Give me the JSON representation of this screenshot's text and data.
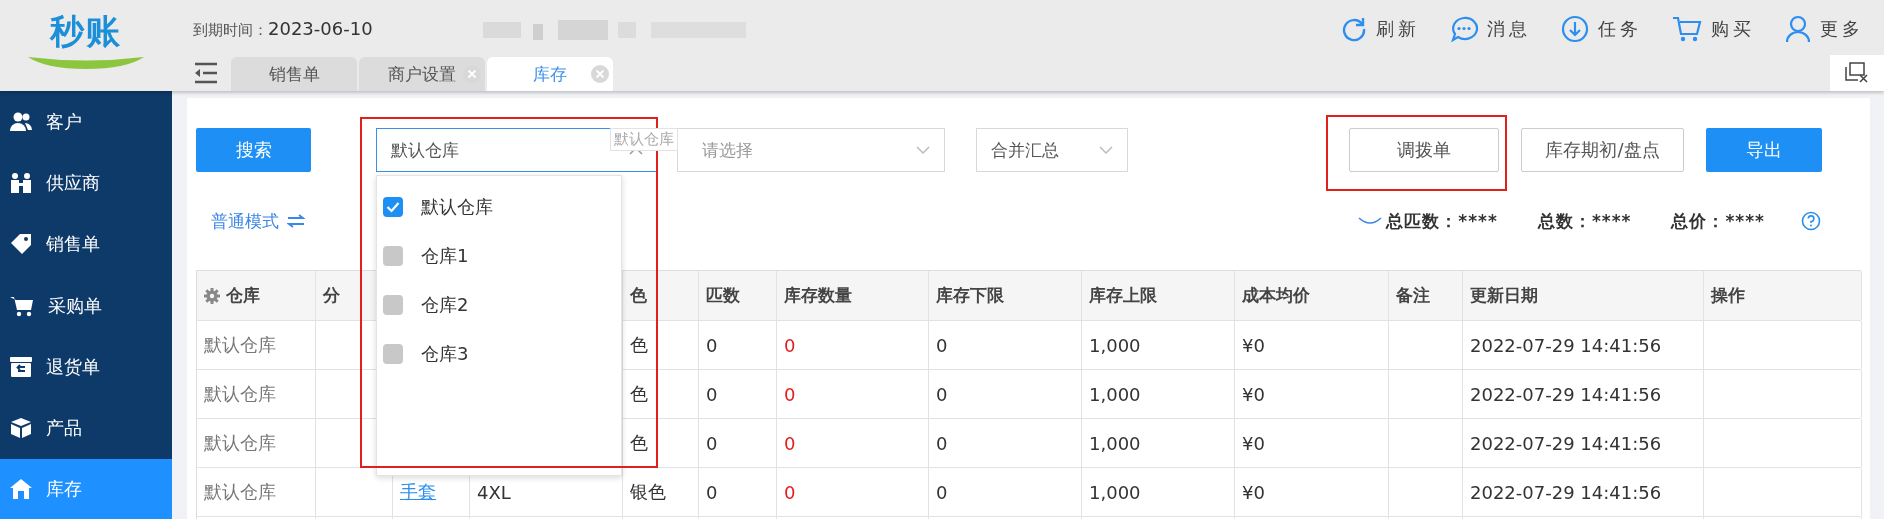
{
  "logo": {
    "text": "秒账"
  },
  "expiry": {
    "label": "到期时间：",
    "value": "2023-06-10"
  },
  "header_actions": [
    {
      "label": "刷新",
      "kind": "refresh"
    },
    {
      "label": "消息",
      "kind": "message"
    },
    {
      "label": "任务",
      "kind": "task"
    },
    {
      "label": "购买",
      "kind": "cart"
    },
    {
      "label": "更多",
      "kind": "user"
    }
  ],
  "tabs": [
    {
      "label": "销售单",
      "selected": false,
      "closable": false
    },
    {
      "label": "商户设置",
      "selected": false,
      "closable": true
    },
    {
      "label": "库存",
      "selected": true,
      "closable": true
    }
  ],
  "sidebar": {
    "items": [
      {
        "label": "客户",
        "kind": "customers",
        "selected": false
      },
      {
        "label": "供应商",
        "kind": "suppliers",
        "selected": false
      },
      {
        "label": "销售单",
        "kind": "tag",
        "selected": false
      },
      {
        "label": "采购单",
        "kind": "cart",
        "selected": false
      },
      {
        "label": "退货单",
        "kind": "return",
        "selected": false
      },
      {
        "label": "产品",
        "kind": "cube",
        "selected": false
      },
      {
        "label": "库存",
        "kind": "house",
        "selected": true
      }
    ]
  },
  "toolbar": {
    "search_button": "搜索",
    "warehouse_select": {
      "value": "默认仓库",
      "expanded": true
    },
    "tooltip": "默认仓库",
    "category_select": {
      "placeholder": "请选择"
    },
    "summary_select": {
      "value": "合并汇总"
    },
    "buttons": [
      {
        "label": "调拨单",
        "primary": false,
        "highlighted": true
      },
      {
        "label": "库存期初/盘点",
        "primary": false,
        "highlighted": false
      },
      {
        "label": "导出",
        "primary": true,
        "highlighted": false
      }
    ]
  },
  "dropdown": {
    "options": [
      {
        "label": "默认仓库",
        "checked": true
      },
      {
        "label": "仓库1",
        "checked": false
      },
      {
        "label": "仓库2",
        "checked": false
      },
      {
        "label": "仓库3",
        "checked": false
      }
    ]
  },
  "mode_toggle": "普通模式",
  "totals": [
    {
      "label": "总匹数：",
      "value": "****"
    },
    {
      "label": "总数：",
      "value": "****"
    },
    {
      "label": "总价：",
      "value": "****"
    }
  ],
  "table": {
    "columns": [
      {
        "label": "仓库",
        "settings": true
      },
      {
        "label": "分"
      },
      {},
      {},
      {
        "label": "色"
      },
      {
        "label": "匹数"
      },
      {
        "label": "库存数量"
      },
      {
        "label": "库存下限"
      },
      {
        "label": "库存上限"
      },
      {
        "label": "成本均价"
      },
      {
        "label": "备注"
      },
      {
        "label": "更新日期"
      },
      {
        "label": "操作"
      }
    ],
    "rows": [
      {
        "cells": [
          "默认仓库",
          null,
          null,
          null,
          "色",
          "0",
          "0",
          "0",
          "1,000",
          "¥0",
          null,
          "2022-07-29 14:41:56",
          null
        ]
      },
      {
        "cells": [
          "默认仓库",
          null,
          null,
          null,
          "色",
          "0",
          "0",
          "0",
          "1,000",
          "¥0",
          null,
          "2022-07-29 14:41:56",
          null
        ]
      },
      {
        "cells": [
          "默认仓库",
          null,
          null,
          null,
          "色",
          "0",
          "0",
          "0",
          "1,000",
          "¥0",
          null,
          "2022-07-29 14:41:56",
          null
        ]
      },
      {
        "cells": [
          "默认仓库",
          null,
          "手套",
          "4XL",
          "银色",
          "0",
          "0",
          "0",
          "1,000",
          "¥0",
          null,
          "2022-07-29 14:41:56",
          null
        ]
      }
    ]
  }
}
